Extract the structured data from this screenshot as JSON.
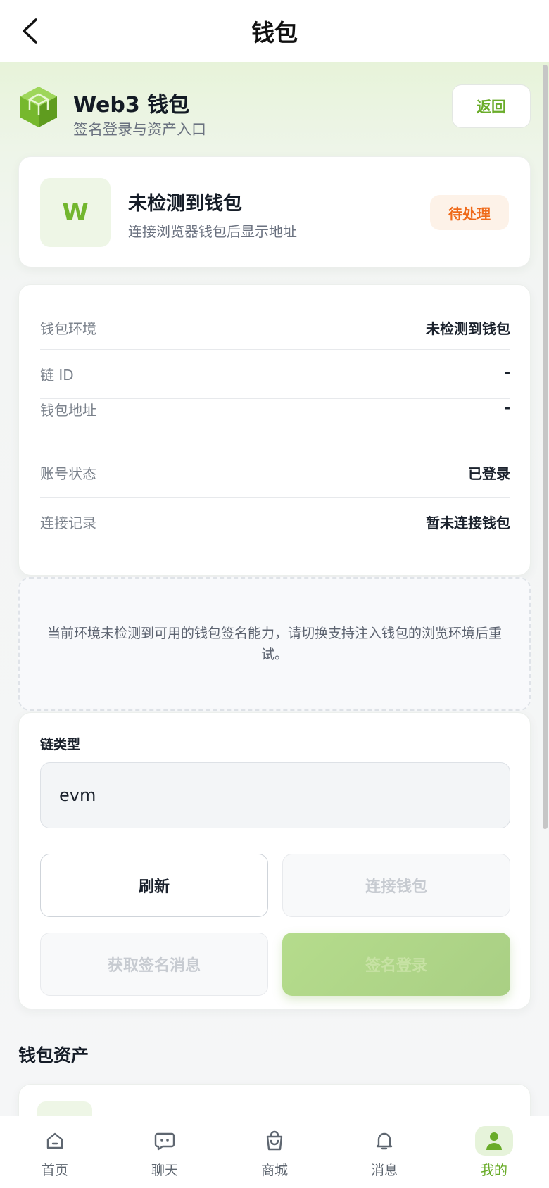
{
  "header": {
    "title": "钱包",
    "back_icon": "chevron-left-icon"
  },
  "hero": {
    "title": "Web3 钱包",
    "subtitle": "签名登录与资产入口",
    "return_label": "返回",
    "logo_icon": "cube-icon",
    "accent": "#6aac2a"
  },
  "status_card": {
    "avatar_letter": "W",
    "title": "未检测到钱包",
    "subtitle": "连接浏览器钱包后显示地址",
    "badge": "待处理",
    "badge_color": "#ef6a1a"
  },
  "info": {
    "rows": [
      {
        "key": "钱包环境",
        "value": "未检测到钱包"
      },
      {
        "key": "链 ID",
        "value": "-"
      },
      {
        "key": "钱包地址",
        "value": "-"
      },
      {
        "key": "账号状态",
        "value": "已登录"
      },
      {
        "key": "连接记录",
        "value": "暂未连接钱包"
      }
    ]
  },
  "notice": "当前环境未检测到可用的钱包签名能力，请切换支持注入钱包的浏览环境后重试。",
  "form": {
    "chain_label": "链类型",
    "chain_value": "evm",
    "refresh_label": "刷新",
    "connect_label": "连接钱包",
    "get_message_label": "获取签名消息",
    "sign_login_label": "签名登录"
  },
  "assets": {
    "section_title": "钱包资产"
  },
  "tabbar": {
    "items": [
      {
        "label": "首页",
        "icon": "home-icon"
      },
      {
        "label": "聊天",
        "icon": "chat-icon"
      },
      {
        "label": "商城",
        "icon": "shopping-bag-icon"
      },
      {
        "label": "消息",
        "icon": "bell-icon"
      },
      {
        "label": "我的",
        "icon": "user-icon",
        "active": true
      }
    ]
  }
}
